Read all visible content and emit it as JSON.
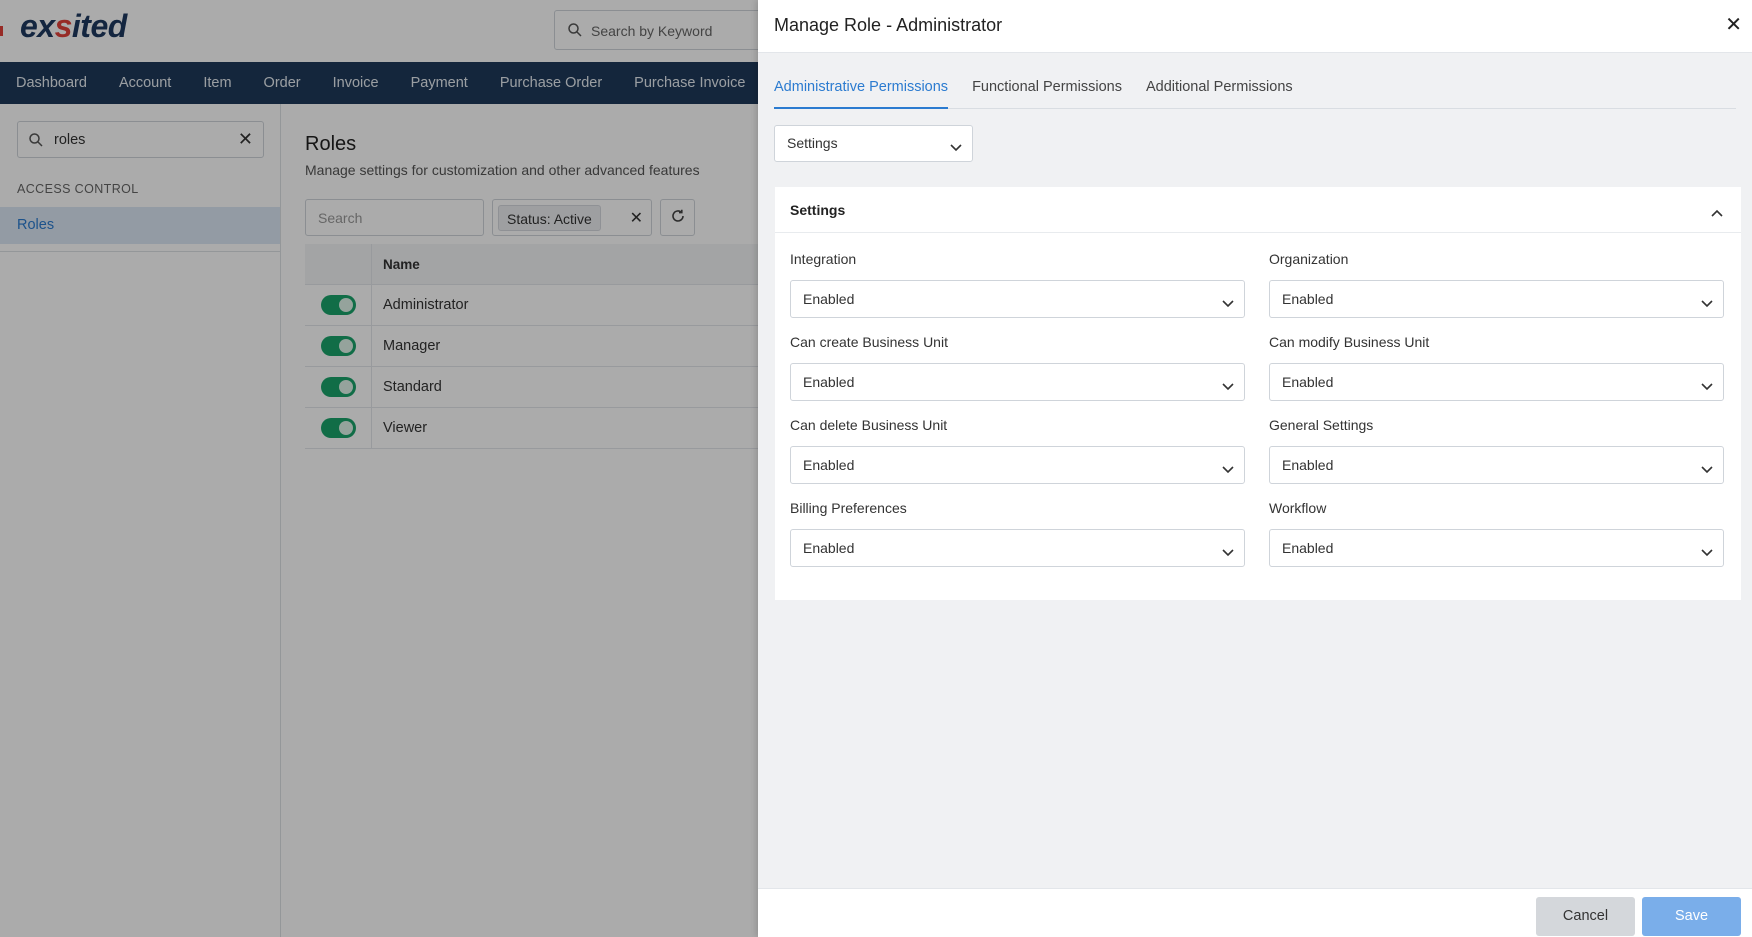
{
  "app": {
    "logo_prefix": "ex",
    "logo_accent": "s",
    "logo_suffix": "ited",
    "keyword_search_placeholder": "Search by Keyword"
  },
  "nav": {
    "items": [
      "Dashboard",
      "Account",
      "Item",
      "Order",
      "Invoice",
      "Payment",
      "Purchase Order",
      "Purchase Invoice"
    ]
  },
  "sidebar": {
    "search_value": "roles",
    "section_label": "ACCESS CONTROL",
    "active_item": "Roles"
  },
  "roles_page": {
    "title": "Roles",
    "subtitle": "Manage settings for customization and other advanced features",
    "search_placeholder": "Search",
    "status_filter": "Status: Active",
    "column_name": "Name",
    "rows": [
      {
        "name": "Administrator",
        "active": true
      },
      {
        "name": "Manager",
        "active": true
      },
      {
        "name": "Standard",
        "active": true
      },
      {
        "name": "Viewer",
        "active": true
      }
    ]
  },
  "drawer": {
    "title": "Manage Role - Administrator",
    "close_glyph": "✕",
    "tabs": [
      {
        "label": "Administrative Permissions",
        "active": true
      },
      {
        "label": "Functional Permissions",
        "active": false
      },
      {
        "label": "Additional Permissions",
        "active": false
      }
    ],
    "section_select_value": "Settings",
    "panel_title": "Settings",
    "fields": [
      {
        "label": "Integration",
        "value": "Enabled"
      },
      {
        "label": "Organization",
        "value": "Enabled"
      },
      {
        "label": "Can create Business Unit",
        "value": "Enabled"
      },
      {
        "label": "Can modify Business Unit",
        "value": "Enabled"
      },
      {
        "label": "Can delete Business Unit",
        "value": "Enabled"
      },
      {
        "label": "General Settings",
        "value": "Enabled"
      },
      {
        "label": "Billing Preferences",
        "value": "Enabled"
      },
      {
        "label": "Workflow",
        "value": "Enabled"
      }
    ],
    "cancel_label": "Cancel",
    "save_label": "Save"
  },
  "colors": {
    "nav_bg": "#1f3a5a",
    "accent_blue": "#2b7bd0",
    "toggle_green": "#1aa36a",
    "save_button": "#7aaeea"
  }
}
